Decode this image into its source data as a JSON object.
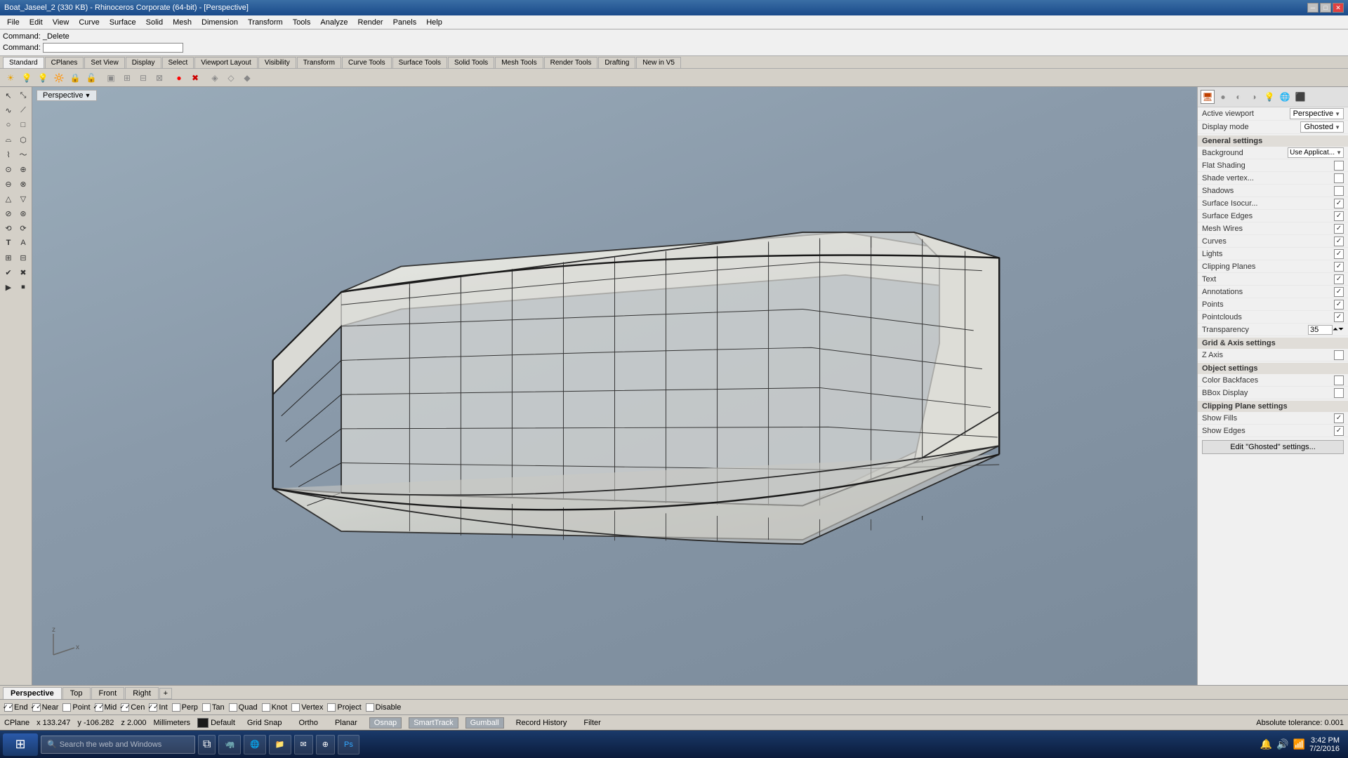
{
  "titlebar": {
    "title": "Boat_Jaseel_2 (330 KB) - Rhinoceros Corporate (64-bit) - [Perspective]",
    "min": "─",
    "max": "□",
    "close": "✕"
  },
  "menubar": {
    "items": [
      "File",
      "Edit",
      "View",
      "Curve",
      "Surface",
      "Solid",
      "Mesh",
      "Dimension",
      "Transform",
      "Tools",
      "Analyze",
      "Render",
      "Panels",
      "Help"
    ]
  },
  "commandarea": {
    "line1": "Command: _Delete",
    "line2": "Command:",
    "placeholder": ""
  },
  "toolbartabs": {
    "tabs": [
      "Standard",
      "CPlanes",
      "Set View",
      "Display",
      "Select",
      "Viewport Layout",
      "Visibility",
      "Transform",
      "Curve Tools",
      "Surface Tools",
      "Solid Tools",
      "Mesh Tools",
      "Render Tools",
      "Drafting",
      "New in V5"
    ]
  },
  "viewport": {
    "label": "Perspective",
    "dropdown_arrow": "▼"
  },
  "rightpanel": {
    "active_viewport_label": "Active viewport",
    "active_viewport_value": "Perspective",
    "display_mode_label": "Display mode",
    "display_mode_value": "Ghosted",
    "general_settings": "General settings",
    "background_label": "Background",
    "background_value": "Use Applicat...",
    "flat_shading_label": "Flat Shading",
    "shade_vertex_label": "Shade vertex...",
    "shadows_label": "Shadows",
    "surface_isocurves_label": "Surface Isocur...",
    "surface_edges_label": "Surface Edges",
    "mesh_wires_label": "Mesh Wires",
    "curves_label": "Curves",
    "lights_label": "Lights",
    "clipping_planes_label": "Clipping Planes",
    "text_label": "Text",
    "annotations_label": "Annotations",
    "points_label": "Points",
    "pointclouds_label": "Pointclouds",
    "transparency_label": "Transparency",
    "transparency_value": "35",
    "grid_axis_settings": "Grid & Axis settings",
    "z_axis_label": "Z Axis",
    "object_settings": "Object settings",
    "color_backfaces_label": "Color Backfaces",
    "bbox_display_label": "BBox Display",
    "clipping_plane_settings": "Clipping Plane settings",
    "show_fills_label": "Show Fills",
    "show_edges_label": "Show Edges",
    "edit_btn": "Edit \"Ghosted\" settings..."
  },
  "viewport_tabs": {
    "tabs": [
      "Perspective",
      "Top",
      "Front",
      "Right"
    ],
    "active": "Perspective"
  },
  "snap_toolbar": {
    "items": [
      {
        "label": "End",
        "checked": true
      },
      {
        "label": "Near",
        "checked": true
      },
      {
        "label": "Point",
        "checked": false
      },
      {
        "label": "Mid",
        "checked": true
      },
      {
        "label": "Cen",
        "checked": true
      },
      {
        "label": "Int",
        "checked": true
      },
      {
        "label": "Perp",
        "checked": false
      },
      {
        "label": "Tan",
        "checked": false
      },
      {
        "label": "Quad",
        "checked": false
      },
      {
        "label": "Knot",
        "checked": false
      },
      {
        "label": "Vertex",
        "checked": false
      },
      {
        "label": "Project",
        "checked": false
      },
      {
        "label": "Disable",
        "checked": false
      }
    ]
  },
  "statusbar": {
    "cplane": "CPlane",
    "x_label": "x",
    "x_value": "133.247",
    "y_label": "y",
    "y_value": "-106.282",
    "z_value": "2.000",
    "units": "Millimeters",
    "layer": "Default",
    "grid_snap": "Grid Snap",
    "ortho": "Ortho",
    "planar": "Planar",
    "osnap": "Osnap",
    "smarttrack": "SmartTrack",
    "gumball": "Gumball",
    "record_history": "Record History",
    "filter": "Filter",
    "tolerance": "Absolute tolerance: 0.001"
  },
  "taskbar": {
    "start_icon": "⊞",
    "search_placeholder": "Search the web and Windows",
    "time": "3:42 PM",
    "date": "7/2/2016",
    "apps": [
      "🖥",
      "🌐",
      "📁",
      "📧",
      "🎭",
      "🟢",
      "🔵",
      "🟡",
      "🔴",
      "🎮"
    ]
  },
  "icons": {
    "left_toolbar": [
      [
        "↖",
        "↗"
      ],
      [
        "✂",
        "📋"
      ],
      [
        "○",
        "□"
      ],
      [
        "⌓",
        "⌗"
      ],
      [
        "∿",
        "~"
      ],
      [
        "⊙",
        "⊕"
      ],
      [
        "⊖",
        "⊗"
      ],
      [
        "△",
        "▽"
      ],
      [
        "⊘",
        "⊛"
      ],
      [
        "⟲",
        "⟳"
      ],
      [
        "T",
        "A"
      ],
      [
        "⊞",
        "⊟"
      ],
      [
        "✔",
        "✖"
      ],
      [
        "▶",
        "⏹"
      ]
    ]
  }
}
